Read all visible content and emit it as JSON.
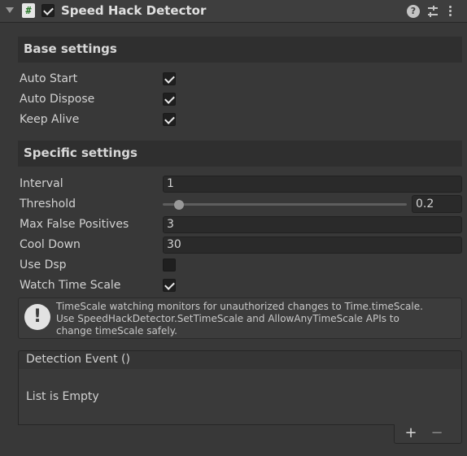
{
  "header": {
    "title": "Speed Hack Detector",
    "enabled": true,
    "script_icon": "#",
    "help_icon": "?"
  },
  "base_settings": {
    "title": "Base settings",
    "fields": [
      {
        "label": "Auto Start",
        "checked": true
      },
      {
        "label": "Auto Dispose",
        "checked": true
      },
      {
        "label": "Keep Alive",
        "checked": true
      }
    ]
  },
  "specific_settings": {
    "title": "Specific settings",
    "interval": {
      "label": "Interval",
      "value": "1"
    },
    "threshold": {
      "label": "Threshold",
      "value": "0.2",
      "fraction": 0.05
    },
    "max_false_positives": {
      "label": "Max False Positives",
      "value": "3"
    },
    "cool_down": {
      "label": "Cool Down",
      "value": "30"
    },
    "use_dsp": {
      "label": "Use Dsp",
      "checked": false
    },
    "watch_time_scale": {
      "label": "Watch Time Scale",
      "checked": true
    }
  },
  "helpbox": {
    "icon": "!",
    "line1": "TimeScale watching monitors for unauthorized changes to Time.timeScale.",
    "line2": "Use SpeedHackDetector.SetTimeScale and AllowAnyTimeScale APIs to",
    "line3": "change timeScale safely."
  },
  "detection_event": {
    "title": "Detection Event ()",
    "empty_text": "List is Empty",
    "add_label": "+",
    "remove_label": "−"
  }
}
